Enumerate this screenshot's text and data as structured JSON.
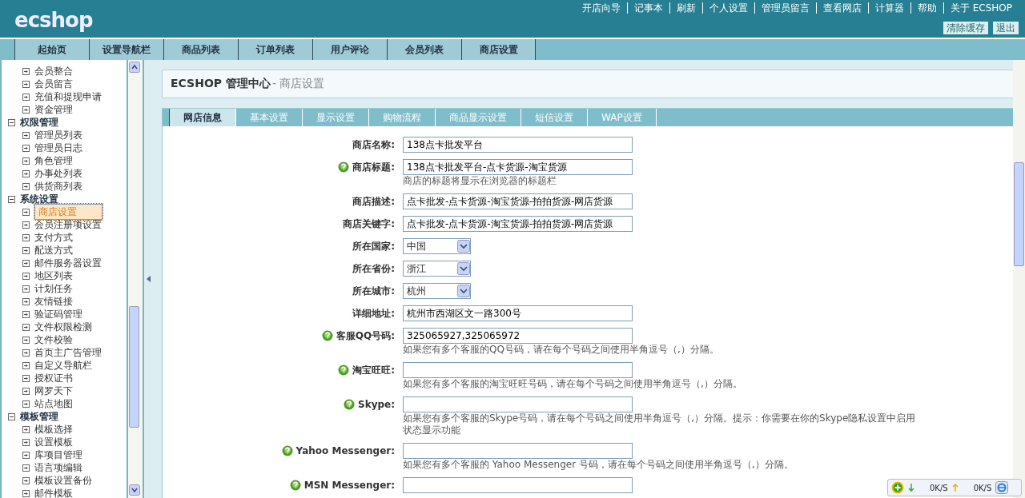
{
  "header": {
    "logo": "ecshop",
    "top_links": [
      "开店向导",
      "记事本",
      "刷新",
      "个人设置",
      "管理员留言",
      "查看网店",
      "计算器",
      "帮助",
      "关于 ECSHOP"
    ],
    "buttons": [
      "清除缓存",
      "退出"
    ]
  },
  "nav_tabs": [
    "起始页",
    "设置导航栏",
    "商品列表",
    "订单列表",
    "用户评论",
    "会员列表",
    "商店设置"
  ],
  "sidebar": {
    "groups": [
      {
        "children": [
          {
            "label": "会员整合",
            "selected": false
          },
          {
            "label": "会员留言",
            "selected": false
          },
          {
            "label": "充值和提现申请",
            "selected": false
          },
          {
            "label": "资金管理",
            "selected": false
          }
        ]
      },
      {
        "label": "权限管理",
        "expanded": true,
        "children": [
          {
            "label": "管理员列表",
            "selected": false
          },
          {
            "label": "管理员日志",
            "selected": false
          },
          {
            "label": "角色管理",
            "selected": false
          },
          {
            "label": "办事处列表",
            "selected": false
          },
          {
            "label": "供货商列表",
            "selected": false
          }
        ]
      },
      {
        "label": "系统设置",
        "expanded": true,
        "children": [
          {
            "label": "商店设置",
            "selected": true
          },
          {
            "label": "会员注册项设置",
            "selected": false
          },
          {
            "label": "支付方式",
            "selected": false
          },
          {
            "label": "配送方式",
            "selected": false
          },
          {
            "label": "邮件服务器设置",
            "selected": false
          },
          {
            "label": "地区列表",
            "selected": false
          },
          {
            "label": "计划任务",
            "selected": false
          },
          {
            "label": "友情链接",
            "selected": false
          },
          {
            "label": "验证码管理",
            "selected": false
          },
          {
            "label": "文件权限检测",
            "selected": false
          },
          {
            "label": "文件校验",
            "selected": false
          },
          {
            "label": "首页主广告管理",
            "selected": false
          },
          {
            "label": "自定义导航栏",
            "selected": false
          },
          {
            "label": "授权证书",
            "selected": false
          },
          {
            "label": "网罗天下",
            "selected": false
          },
          {
            "label": "站点地图",
            "selected": false
          }
        ]
      },
      {
        "label": "模板管理",
        "expanded": true,
        "children": [
          {
            "label": "模板选择",
            "selected": false
          },
          {
            "label": "设置模板",
            "selected": false
          },
          {
            "label": "库项目管理",
            "selected": false
          },
          {
            "label": "语言项编辑",
            "selected": false
          },
          {
            "label": "模板设置备份",
            "selected": false
          },
          {
            "label": "邮件模板",
            "selected": false
          }
        ]
      }
    ]
  },
  "page_title": {
    "main": "ECSHOP 管理中心",
    "sub": "- 商店设置"
  },
  "tabs": [
    {
      "label": "网店信息",
      "selected": true
    },
    {
      "label": "基本设置",
      "selected": false
    },
    {
      "label": "显示设置",
      "selected": false
    },
    {
      "label": "购物流程",
      "selected": false
    },
    {
      "label": "商品显示设置",
      "selected": false
    },
    {
      "label": "短信设置",
      "selected": false
    },
    {
      "label": "WAP设置",
      "selected": false
    }
  ],
  "form": [
    {
      "label": "商店名称:",
      "help": false,
      "kind": "text",
      "value": "138点卡批发平台"
    },
    {
      "label": "商店标题:",
      "help": true,
      "kind": "text",
      "value": "138点卡批发平台-点卡货源-淘宝货源",
      "hint": "商店的标题将显示在浏览器的标题栏"
    },
    {
      "label": "商店描述:",
      "help": false,
      "kind": "text",
      "value": "点卡批发-点卡货源-淘宝货源-拍拍货源-网店货源"
    },
    {
      "label": "商店关键字:",
      "help": false,
      "kind": "text",
      "value": "点卡批发-点卡货源-淘宝货源-拍拍货源-网店货源"
    },
    {
      "label": "所在国家:",
      "help": false,
      "kind": "select",
      "value": "中国"
    },
    {
      "label": "所在省份:",
      "help": false,
      "kind": "select",
      "value": "浙江"
    },
    {
      "label": "所在城市:",
      "help": false,
      "kind": "select",
      "value": "杭州"
    },
    {
      "label": "详细地址:",
      "help": false,
      "kind": "text",
      "value": "杭州市西湖区文一路300号"
    },
    {
      "label": "客服QQ号码:",
      "help": true,
      "kind": "text",
      "value": "325065927,325065972",
      "hint": "如果您有多个客服的QQ号码，请在每个号码之间使用半角逗号（,）分隔。"
    },
    {
      "label": "淘宝旺旺:",
      "help": true,
      "kind": "text",
      "hint": "如果您有多个客服的淘宝旺旺号码，请在每个号码之间使用半角逗号（,）分隔。"
    },
    {
      "label": "Skype:",
      "help": true,
      "kind": "text",
      "hint": "如果您有多个客服的Skype号码，请在每个号码之间使用半角逗号（,）分隔。提示：你需要在你的Skype隐私设置中启用状态显示功能"
    },
    {
      "label": "Yahoo Messenger:",
      "help": true,
      "kind": "text",
      "hint": "如果您有多个客服的 Yahoo Messenger 号码，请在每个号码之间使用半角逗号（,）分隔。"
    },
    {
      "label": "MSN Messenger:",
      "help": true,
      "kind": "text"
    }
  ],
  "speed_widget": {
    "download": "0K/S",
    "upload": "0K/S"
  }
}
